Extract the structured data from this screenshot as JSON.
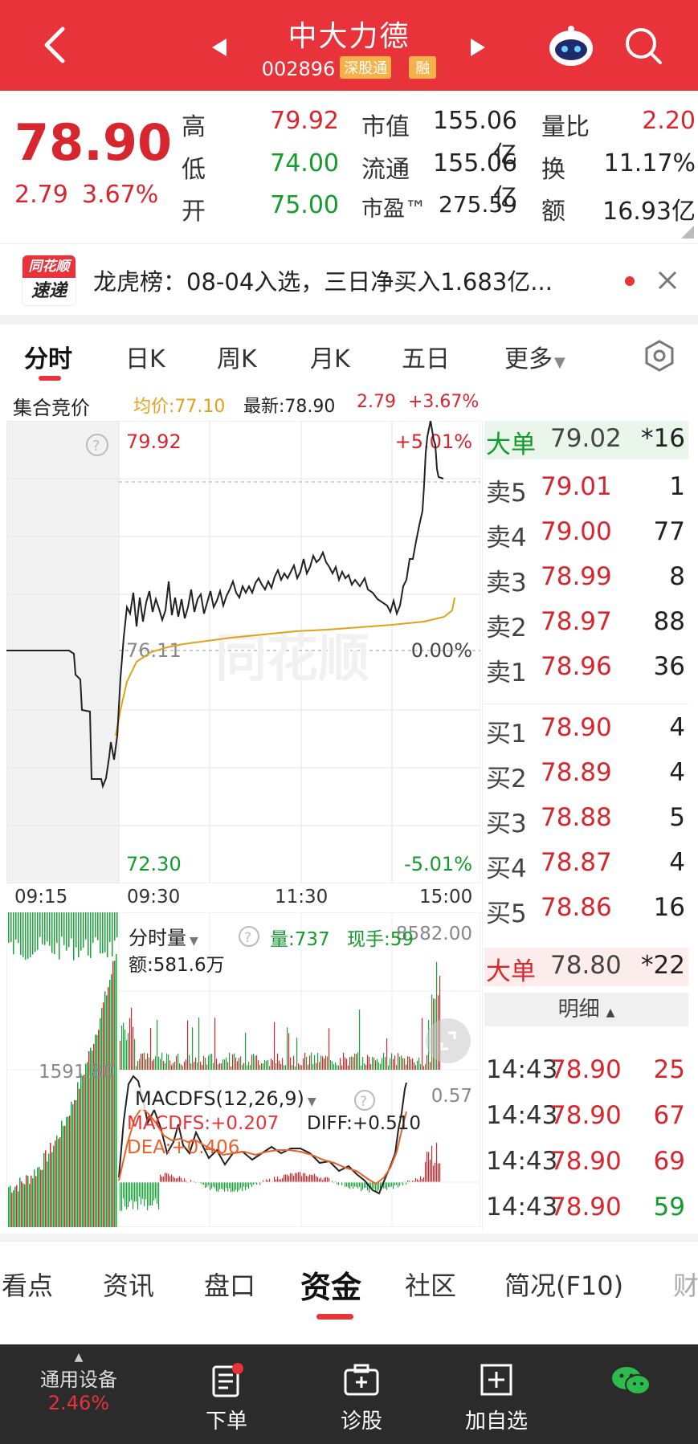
{
  "header": {
    "title": "中大力德",
    "code": "002896",
    "tag_connect": "深股通",
    "tag_margin": "融"
  },
  "quote": {
    "price": "78.90",
    "change": "2.79",
    "change_pct": "3.67%",
    "high_label": "高",
    "high": "79.92",
    "low_label": "低",
    "low": "74.00",
    "open_label": "开",
    "open": "75.00",
    "mcap_label": "市值",
    "mcap": "155.06亿",
    "float_label": "流通",
    "float": "155.06亿",
    "pe_label": "市盈™",
    "pe": "275.59",
    "vr_label": "量比",
    "vr": "2.20",
    "turn_label": "换",
    "turn": "11.17%",
    "amt_label": "额",
    "amt": "16.93亿"
  },
  "notice": {
    "logo_top": "同花顺",
    "logo_bottom": "速递",
    "text": "龙虎榜：08-04入选，三日净买入1.683亿..."
  },
  "tabs": [
    "分时",
    "日K",
    "周K",
    "月K",
    "五日",
    "更多"
  ],
  "info": {
    "auction": "集合竞价",
    "avg": "均价:77.10",
    "latest": "最新:78.90",
    "chg": "2.79",
    "pct": "+3.67%"
  },
  "price_chart": {
    "top_left": "79.92",
    "top_right": "+5.01%",
    "mid_left": "76.11",
    "mid_right": "0.00%",
    "bot_left": "72.30",
    "bot_right": "-5.01%",
    "times": [
      "09:15",
      "09:30",
      "11:30",
      "15:00"
    ],
    "watermark": "同花顺"
  },
  "volume_panel": {
    "label": "分时量",
    "vol": "量:737",
    "hand": "现手:59",
    "max": "8582.00",
    "amount": "额:581.6万",
    "left_val": "1591.80"
  },
  "macd_panel": {
    "label": "MACDFS(12,26,9)",
    "macd": "MACDFS:+0.207",
    "diff": "DIFF:+0.510",
    "dea": "DEA:+0.406",
    "max": "0.57"
  },
  "order_book": {
    "big_sell": {
      "label": "大单",
      "price": "79.02",
      "vol": "*16"
    },
    "asks": [
      {
        "label": "卖5",
        "price": "79.01",
        "vol": "1"
      },
      {
        "label": "卖4",
        "price": "79.00",
        "vol": "77"
      },
      {
        "label": "卖3",
        "price": "78.99",
        "vol": "8"
      },
      {
        "label": "卖2",
        "price": "78.97",
        "vol": "88"
      },
      {
        "label": "卖1",
        "price": "78.96",
        "vol": "36"
      }
    ],
    "bids": [
      {
        "label": "买1",
        "price": "78.90",
        "vol": "4"
      },
      {
        "label": "买2",
        "price": "78.89",
        "vol": "4"
      },
      {
        "label": "买3",
        "price": "78.88",
        "vol": "5"
      },
      {
        "label": "买4",
        "price": "78.87",
        "vol": "4"
      },
      {
        "label": "买5",
        "price": "78.86",
        "vol": "16"
      }
    ],
    "big_buy": {
      "label": "大单",
      "price": "78.80",
      "vol": "*22"
    },
    "detail_label": "明细",
    "trades": [
      {
        "time": "14:43",
        "price": "78.90",
        "vol": "25",
        "color": "red"
      },
      {
        "time": "14:43",
        "price": "78.90",
        "vol": "67",
        "color": "red"
      },
      {
        "time": "14:43",
        "price": "78.90",
        "vol": "69",
        "color": "red"
      },
      {
        "time": "14:43",
        "price": "78.90",
        "vol": "59",
        "color": "green"
      }
    ]
  },
  "bottom_tabs": [
    "看点",
    "资讯",
    "盘口",
    "资金",
    "社区",
    "简况(F10)",
    "财"
  ],
  "footer": {
    "index_name": "通用设备",
    "index_pct": "2.46%",
    "order": "下单",
    "diagnose": "诊股",
    "add": "加自选"
  },
  "colors": {
    "brand": "#e8333a",
    "up": "#d8262e",
    "down": "#139b2b",
    "avg_line": "#e0a21a"
  }
}
